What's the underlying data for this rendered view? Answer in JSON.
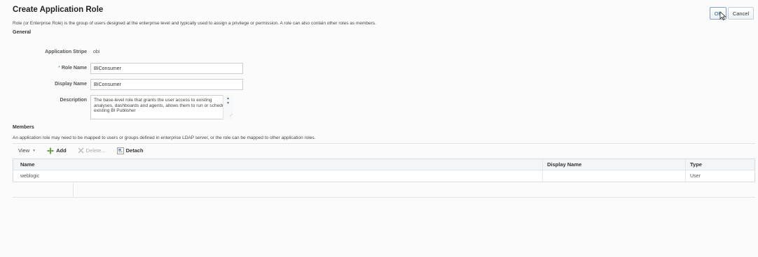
{
  "page": {
    "title": "Create Application Role",
    "subtitle": "Role (or Enterprise Role) is the group of users designed at the enterprise level and typically used to assign a privilege or permission. A role can also contain other roles as members."
  },
  "buttons": {
    "ok": "OK",
    "cancel": "Cancel"
  },
  "general": {
    "section_label": "General",
    "stripe_label": "Application Stripe",
    "stripe_value": "obi",
    "role_name_required": "*",
    "role_name_label": "Role Name",
    "role_name_value": "BIConsumer",
    "display_name_label": "Display Name",
    "display_name_value": "BIConsumer",
    "description_label": "Description",
    "description_value": "The base-level role that grants the user access to existing analyses, dashboards and agents, allows them to run or schedule existing BI Publisher"
  },
  "members": {
    "section_label": "Members",
    "description": "An application role may need to be mapped to users or groups defined in enterprise LDAP server, or the role can be mapped to other application roles.",
    "toolbar": {
      "view": "View",
      "add": "Add",
      "delete": "Delete...",
      "detach": "Detach"
    },
    "columns": [
      "Name",
      "Display Name",
      "Type"
    ],
    "rows": [
      {
        "name": "weblogic",
        "display_name": "",
        "type": "User"
      }
    ]
  },
  "colors": {
    "accent": "#3a7ec1",
    "add_icon": "#6aa84f"
  }
}
